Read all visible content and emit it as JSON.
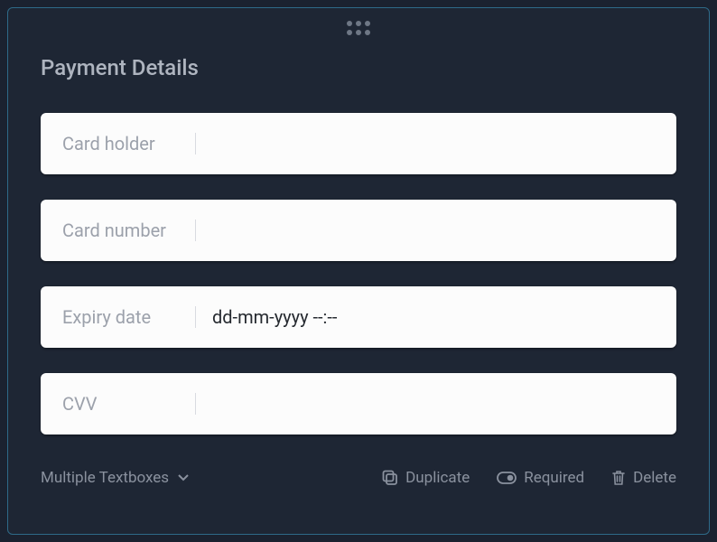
{
  "title": "Payment Details",
  "fields": [
    {
      "label": "Card holder",
      "value": ""
    },
    {
      "label": "Card number",
      "value": ""
    },
    {
      "label": "Expiry date",
      "value": "dd-mm-yyyy --:--"
    },
    {
      "label": "CVV",
      "value": ""
    }
  ],
  "toolbar": {
    "type_label": "Multiple Textboxes",
    "duplicate": "Duplicate",
    "required": "Required",
    "delete": "Delete"
  }
}
